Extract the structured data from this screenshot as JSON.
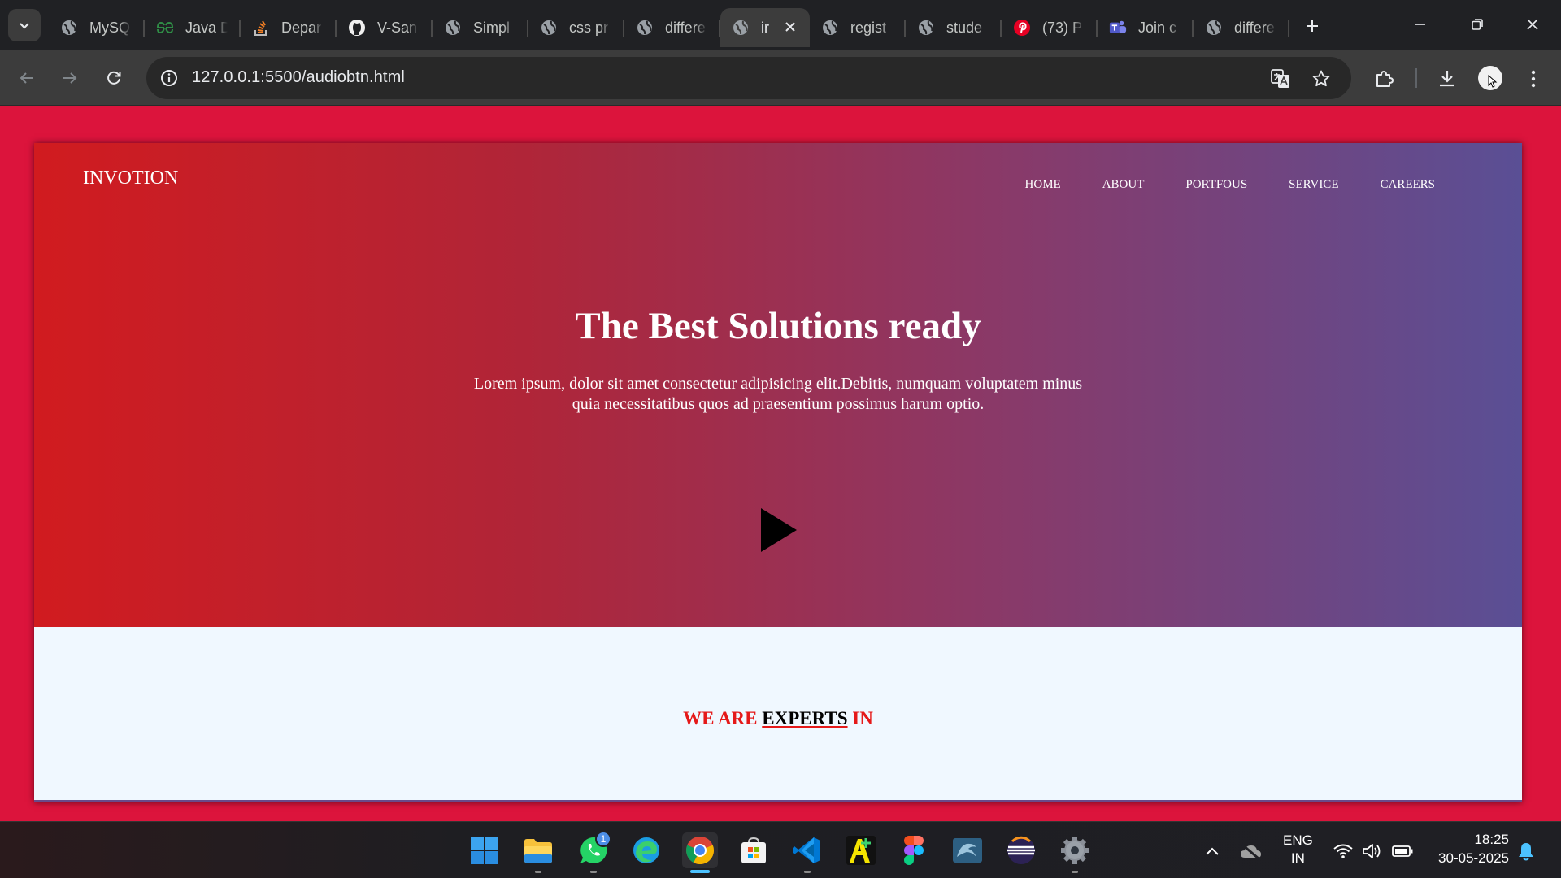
{
  "browser": {
    "tabs": [
      {
        "label": "MySQ",
        "icon": "globe-icon"
      },
      {
        "label": "Java D",
        "icon": "gfg-icon"
      },
      {
        "label": "Depar",
        "icon": "stackoverflow-icon"
      },
      {
        "label": "V-San",
        "icon": "github-icon"
      },
      {
        "label": "Simpl",
        "icon": "globe-icon"
      },
      {
        "label": "css pr",
        "icon": "globe-icon"
      },
      {
        "label": "differe",
        "icon": "globe-icon"
      },
      {
        "label": "ir",
        "icon": "globe-icon",
        "active": true
      },
      {
        "label": "regist",
        "icon": "globe-icon"
      },
      {
        "label": "stude",
        "icon": "globe-icon"
      },
      {
        "label": "(73) P",
        "icon": "pinterest-icon"
      },
      {
        "label": "Join c",
        "icon": "teams-icon"
      },
      {
        "label": "differe",
        "icon": "globe-icon"
      }
    ],
    "url": "127.0.0.1:5500/audiobtn.html"
  },
  "page": {
    "brand": "INVOTION",
    "nav": [
      "HOME",
      "ABOUT",
      "PORTFOUS",
      "SERVICE",
      "CAREERS"
    ],
    "headline": "The Best Solutions ready",
    "lead": "Lorem ipsum, dolor sit amet consectetur adipisicing elit.Debitis, numquam voluptatem minus quia necessitatibus quos ad praesentium possimus harum optio.",
    "experts": {
      "prefix": "WE ARE ",
      "highlight": "EXPERTS",
      "suffix": " IN"
    }
  },
  "taskbar": {
    "apps": [
      "windows-start-icon",
      "file-explorer-icon",
      "whatsapp-icon",
      "edge-icon",
      "chrome-icon",
      "microsoft-store-icon",
      "vscode-icon",
      "font-app-icon",
      "figma-icon",
      "mysql-workbench-icon",
      "eclipse-icon",
      "settings-icon"
    ],
    "whatsapp_badge": "1",
    "lang_line1": "ENG",
    "lang_line2": "IN",
    "time": "18:25",
    "date": "30-05-2025"
  },
  "colors": {
    "page_bg": "#dc143c",
    "hero_gradient_start": "#d11b1f",
    "hero_gradient_end": "#5a4f95",
    "experts_accent": "#e51919"
  }
}
